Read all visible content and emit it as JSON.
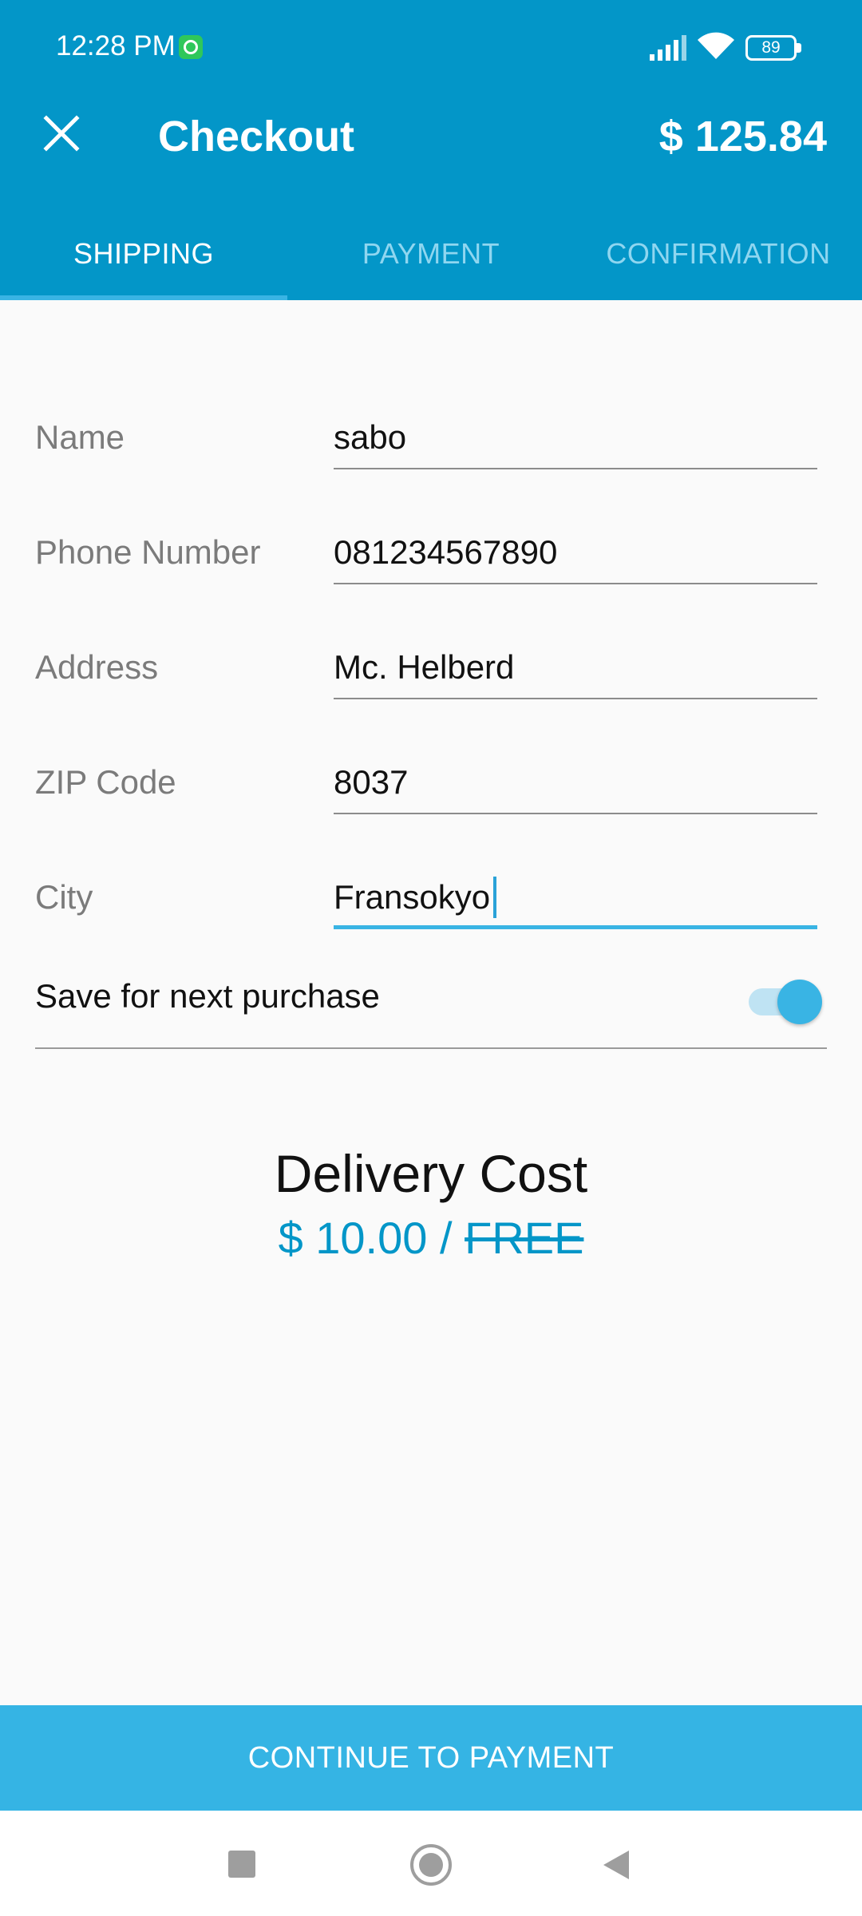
{
  "status_bar": {
    "time": "12:28 PM",
    "notification_icon": "whatsapp-icon",
    "battery": "89"
  },
  "header": {
    "title": "Checkout",
    "total": "$ 125.84",
    "close_icon": "close-icon"
  },
  "tabs": [
    {
      "label": "SHIPPING",
      "active": true
    },
    {
      "label": "PAYMENT",
      "active": false
    },
    {
      "label": "CONFIRMATION",
      "active": false
    }
  ],
  "form": {
    "fields": [
      {
        "label": "Name",
        "value": "sabo"
      },
      {
        "label": "Phone Number",
        "value": "081234567890"
      },
      {
        "label": "Address",
        "value": "Mc. Helberd"
      },
      {
        "label": "ZIP Code",
        "value": "8037"
      },
      {
        "label": "City",
        "value": "Fransokyo",
        "focused": true
      }
    ],
    "save_toggle": {
      "label": "Save for next purchase",
      "on": true
    }
  },
  "delivery": {
    "title": "Delivery Cost",
    "price": "$ 10.00 / ",
    "free_label": "FREE"
  },
  "continue_button": {
    "label": "CONTINUE TO PAYMENT"
  },
  "colors": {
    "primary": "#0396c8",
    "accent": "#35b4e4",
    "inactive_tab": "#8fd6f0"
  }
}
